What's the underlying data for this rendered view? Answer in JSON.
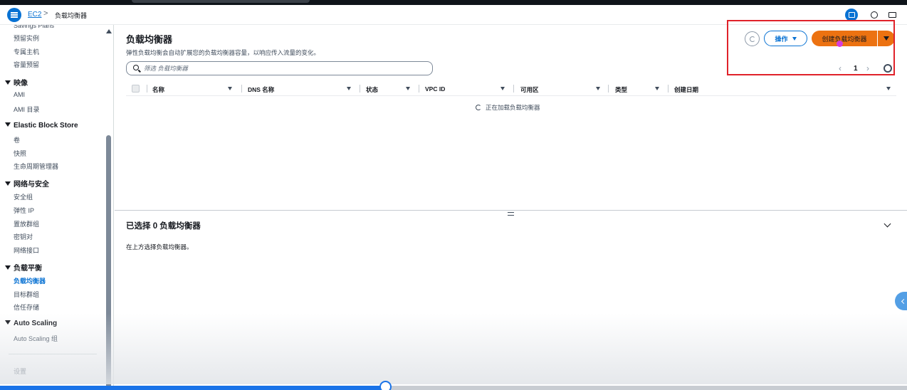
{
  "header": {
    "breadcrumb_root": "EC2",
    "breadcrumb_separator": ">",
    "breadcrumb_current": "负载均衡器"
  },
  "sidebar": {
    "items": [
      {
        "label": "Savings Plans",
        "type": "item"
      },
      {
        "label": "预留实例",
        "type": "item"
      },
      {
        "label": "专属主机",
        "type": "item"
      },
      {
        "label": "容量预留",
        "type": "item"
      },
      {
        "label": "映像",
        "type": "section"
      },
      {
        "label": "AMI",
        "type": "item"
      },
      {
        "label": "AMI 目录",
        "type": "item"
      },
      {
        "label": "Elastic Block Store",
        "type": "section"
      },
      {
        "label": "卷",
        "type": "item"
      },
      {
        "label": "快照",
        "type": "item"
      },
      {
        "label": "生命周期管理器",
        "type": "item"
      },
      {
        "label": "网络与安全",
        "type": "section"
      },
      {
        "label": "安全组",
        "type": "item"
      },
      {
        "label": "弹性 IP",
        "type": "item"
      },
      {
        "label": "置放群组",
        "type": "item"
      },
      {
        "label": "密钥对",
        "type": "item"
      },
      {
        "label": "网络接口",
        "type": "item"
      },
      {
        "label": "负载平衡",
        "type": "section"
      },
      {
        "label": "负载均衡器",
        "type": "item",
        "active": true
      },
      {
        "label": "目标群组",
        "type": "item"
      },
      {
        "label": "信任存储",
        "type": "item"
      },
      {
        "label": "Auto Scaling",
        "type": "section"
      },
      {
        "label": "Auto Scaling 组",
        "type": "item"
      },
      {
        "label": "设置",
        "type": "item"
      }
    ]
  },
  "main": {
    "title": "负载均衡器",
    "description": "弹性负载均衡会自动扩展您的负载均衡器容量，以响应传入流量的变化。",
    "actions_label": "操作",
    "create_label": "创建负载均衡器",
    "search_placeholder": "筛选 负载均衡器",
    "current_page": "1",
    "columns": [
      "名称",
      "DNS 名称",
      "状态",
      "VPC ID",
      "可用区",
      "类型",
      "创建日期"
    ],
    "loading_text": "正在加载负载均衡器",
    "selected_title": "已选择 0 负载均衡器",
    "selected_hint": "在上方选择负载均衡器。"
  },
  "colors": {
    "accent": "#0972d3",
    "primary_button": "#ec7211",
    "highlight_box": "#e0222a"
  },
  "video": {
    "progress_fraction": 0.425
  }
}
